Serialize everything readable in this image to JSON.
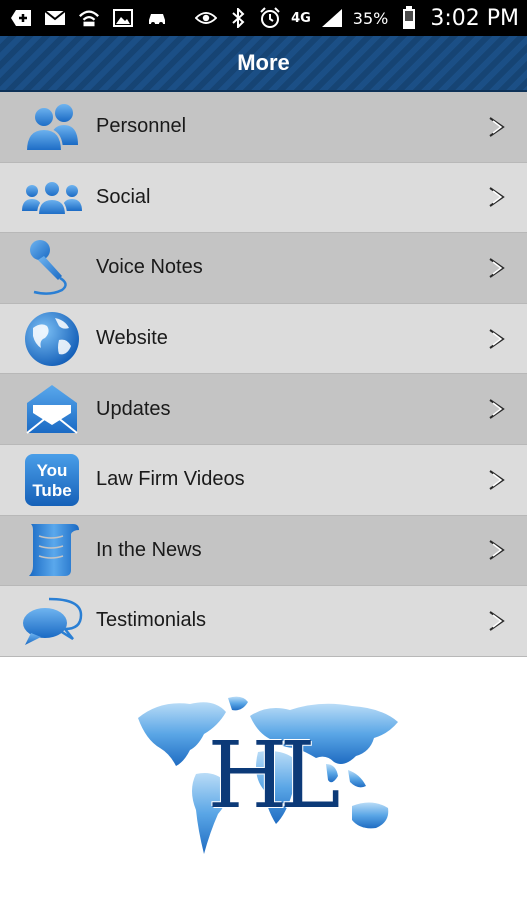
{
  "status_bar": {
    "battery_percent": "35%",
    "time": "3:02 PM",
    "network": "4G",
    "icons": [
      "add-icon",
      "mail-icon",
      "wifi-hotspot-icon",
      "image-icon",
      "car-icon",
      "eye-icon",
      "bluetooth-icon",
      "alarm-icon",
      "signal-icon",
      "battery-icon"
    ]
  },
  "header": {
    "title": "More"
  },
  "menu": {
    "items": [
      {
        "label": "Personnel",
        "icon": "people-icon"
      },
      {
        "label": "Social",
        "icon": "group-icon"
      },
      {
        "label": "Voice Notes",
        "icon": "microphone-icon"
      },
      {
        "label": "Website",
        "icon": "globe-icon"
      },
      {
        "label": "Updates",
        "icon": "envelope-icon"
      },
      {
        "label": "Law Firm Videos",
        "icon": "youtube-icon",
        "icon_text_top": "You",
        "icon_text_bottom": "Tube"
      },
      {
        "label": "In the News",
        "icon": "scroll-icon"
      },
      {
        "label": "Testimonials",
        "icon": "speech-bubbles-icon"
      }
    ]
  },
  "logo": {
    "text": "HL"
  },
  "colors": {
    "header_blue": "#1b4f86",
    "icon_blue": "#2a7fd4",
    "row_dark": "#c4c4c4",
    "row_light": "#dcdcdc"
  }
}
